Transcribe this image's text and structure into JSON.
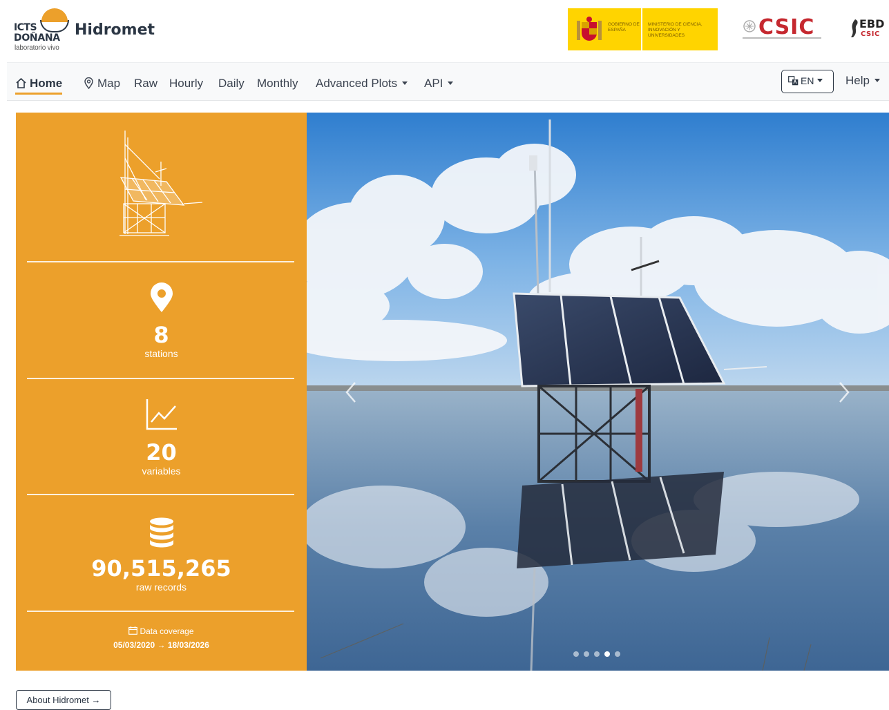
{
  "brand": {
    "org_line1": "ICTS",
    "org_line2": "DOÑANA",
    "org_tagline": "laboratorio vivo",
    "app_name": "Hidromet"
  },
  "partners": {
    "government": "GOBIERNO DE ESPAÑA",
    "ministry": "MINISTERIO DE CIENCIA, INNOVACIÓN Y UNIVERSIDADES",
    "csic": "CSIC",
    "ebd": "EBD",
    "ebd_sub": "CSIC"
  },
  "nav": {
    "items": [
      {
        "label": "Home",
        "icon": "home-icon",
        "active": true
      },
      {
        "label": "Map",
        "icon": "map-pin-icon"
      },
      {
        "label": "Raw"
      },
      {
        "label": "Hourly"
      },
      {
        "label": "Daily"
      },
      {
        "label": "Monthly"
      },
      {
        "label": "Advanced Plots",
        "dropdown": true
      },
      {
        "label": "API",
        "dropdown": true
      }
    ],
    "language": "EN",
    "help": "Help"
  },
  "stats": {
    "stations": {
      "value": "8",
      "label": "stations",
      "icon": "map-pin-icon"
    },
    "variables": {
      "value": "20",
      "label": "variables",
      "icon": "line-chart-icon"
    },
    "records": {
      "value": "90,515,265",
      "label": "raw records",
      "icon": "database-icon"
    },
    "coverage": {
      "title": "Data coverage",
      "range": "05/03/2020 → 18/03/2026",
      "icon": "calendar-icon"
    }
  },
  "carousel": {
    "slides": 5,
    "active_slide": 4
  },
  "about": {
    "label": "About Hidromet →"
  },
  "colors": {
    "accent": "#eca02b",
    "dark": "#2b3644",
    "nav_bg": "#f8f9fa",
    "csic_red": "#c5282f",
    "gov_yellow": "#ffd400"
  }
}
